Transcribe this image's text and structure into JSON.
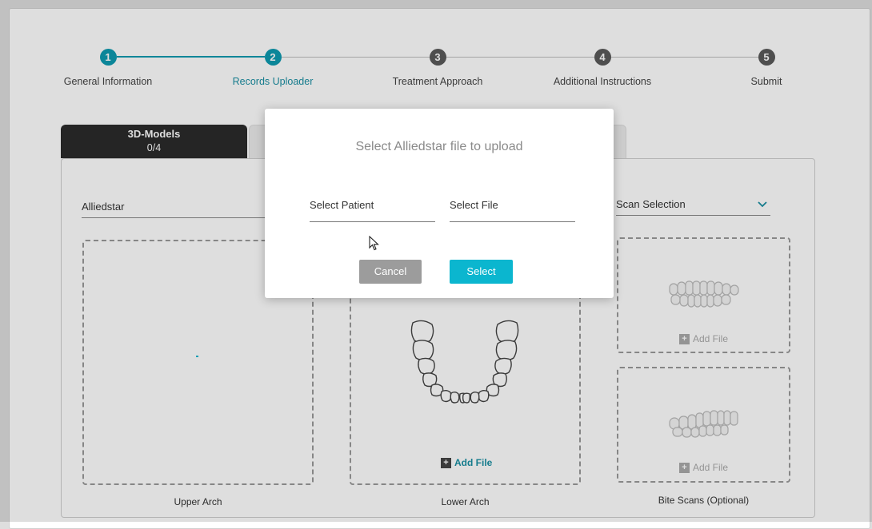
{
  "stepper": {
    "steps": [
      {
        "number": "1",
        "label": "General Information",
        "state": "completed"
      },
      {
        "number": "2",
        "label": "Records Uploader",
        "state": "current"
      },
      {
        "number": "3",
        "label": "Treatment Approach",
        "state": "pending"
      },
      {
        "number": "4",
        "label": "Additional Instructions",
        "state": "pending"
      },
      {
        "number": "5",
        "label": "Submit",
        "state": "pending"
      }
    ]
  },
  "tabs": {
    "active": {
      "title": "3D-Models",
      "count": "0/4"
    }
  },
  "panel": {
    "source_value": "Alliedstar",
    "scan_selection_label": "Scan Selection",
    "add_file_label": "Add File",
    "upper_arch_caption": "Upper Arch",
    "lower_arch_caption": "Lower Arch",
    "bite_scans_caption": "Bite Scans (Optional)"
  },
  "modal": {
    "title": "Select Alliedstar file to upload",
    "patient_placeholder": "Select Patient",
    "file_placeholder": "Select File",
    "cancel_label": "Cancel",
    "select_label": "Select"
  },
  "colors": {
    "accent": "#0d9ab0",
    "select_button": "#0bb6cf",
    "cancel_button": "#9c9c9c"
  }
}
